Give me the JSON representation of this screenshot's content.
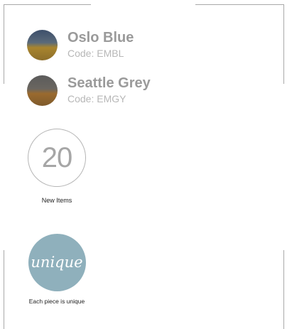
{
  "swatches": [
    {
      "name": "Oslo Blue",
      "code": "Code: EMBL",
      "colors": {
        "top": "#3d4f6b",
        "bottom": "#a8852e"
      }
    },
    {
      "name": "Seattle Grey",
      "code": "Code: EMGY",
      "colors": {
        "top": "#5b5b5b",
        "bottom": "#9a6a2e"
      }
    }
  ],
  "counter": {
    "value": "20",
    "label": "New Items"
  },
  "unique": {
    "script_text": "unique",
    "caption": "Each piece is unique",
    "color": "#8fb0bc"
  },
  "colors": {
    "frame": "#a9a9a9",
    "swatch_name": "#9a9a9a",
    "swatch_code": "#b7b7b7"
  }
}
